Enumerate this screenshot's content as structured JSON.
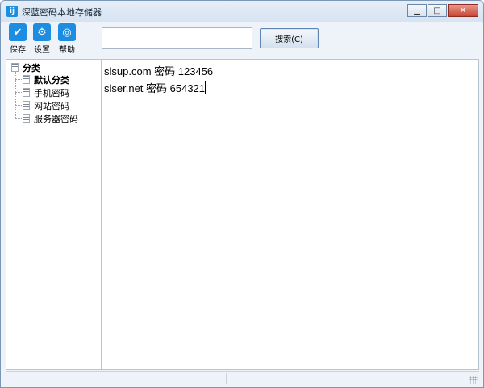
{
  "window": {
    "title": "深蓝密码本地存储器",
    "app_icon_glyph": "ij",
    "minimize": "▁",
    "maximize": "□",
    "close": "✕"
  },
  "toolbar": {
    "save": {
      "label": "保存",
      "icon": "checkmark-icon",
      "glyph": "✔"
    },
    "settings": {
      "label": "设置",
      "icon": "gear-icon",
      "glyph": "⚙"
    },
    "help": {
      "label": "帮助",
      "icon": "lightbulb-icon",
      "glyph": "◎"
    },
    "search_value": "",
    "search_button": "搜索(C)"
  },
  "tree": {
    "root": "分类",
    "children": [
      "默认分类",
      "手机密码",
      "网站密码",
      "服务器密码"
    ]
  },
  "editor": {
    "lines": [
      "slsup.com 密码 123456",
      "slser.net 密码 654321"
    ]
  },
  "colors": {
    "accent": "#1c8de0",
    "window_bg": "#eef3fa",
    "border": "#b7c4d4"
  }
}
